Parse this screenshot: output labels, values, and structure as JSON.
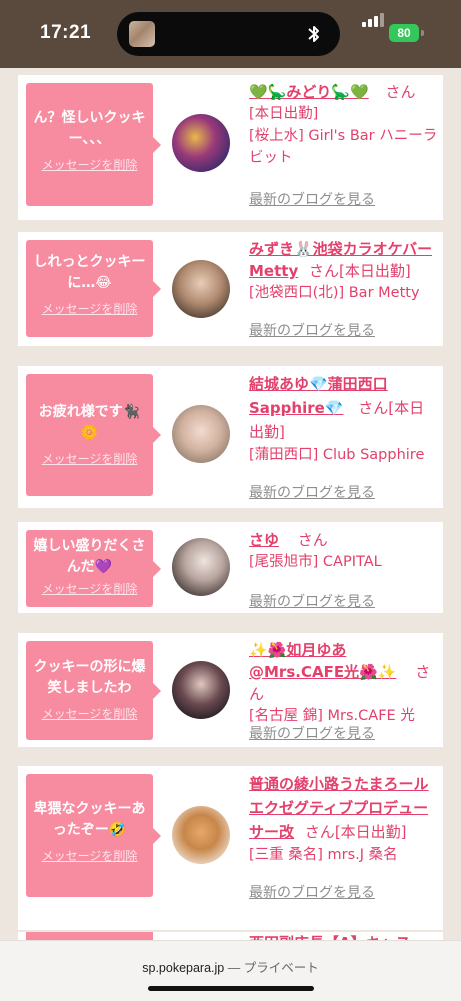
{
  "status_bar": {
    "time": "17:21",
    "battery": "80",
    "colors": {
      "background": "#5a4a3d",
      "battery": "#34c759"
    }
  },
  "accent_colors": {
    "pink": "#f78ca1",
    "name": "#e3416c",
    "muted": "#8e8e8e"
  },
  "delete_label": "メッセージを削除",
  "blog_label": "最新のブログを見る",
  "san_suffix": "さん",
  "cards": [
    {
      "message": "ん？怪しいクッキー、、、",
      "name": "💚🦕みどり🦕💚",
      "status": "[本日出勤]",
      "store": "[桜上水] Girl's Bar ハニーラビット"
    },
    {
      "message": "しれっとクッキーに…😂",
      "name": "みずき🐰池袋カラオケバーMetty",
      "status": "[本日出勤]",
      "store": "[池袋西口(北)] Bar Metty"
    },
    {
      "message": "お疲れ様です🐈‍⬛🌼",
      "name": "結城あゆ💎蒲田西口Sapphire💎",
      "status": "[本日出勤]",
      "store": "[蒲田西口] Club Sapphire"
    },
    {
      "message": "嬉しい盛りだくさんだ💜",
      "name": "さゆ",
      "status": "",
      "store": "[尾張旭市] CAPITAL"
    },
    {
      "message": "クッキーの形に爆笑しましたわ",
      "name": "✨🌺如月ゆあ@Mrs.CAFE光🌺✨",
      "status": "",
      "store": "[名古屋 錦] Mrs.CAFE 光"
    },
    {
      "message": "卑猥なクッキーあったぞー🤣",
      "name": "普通の綾小路うたまろールエクゼグティブプロデューサー改",
      "status": "[本日出勤]",
      "store": "[三重 桑名] mrs.J 桑名"
    }
  ],
  "partial_card": {
    "name": "西田副店長【A】キャス"
  },
  "browser": {
    "url": "sp.pokepara.jp",
    "mode": "— プライベート"
  }
}
